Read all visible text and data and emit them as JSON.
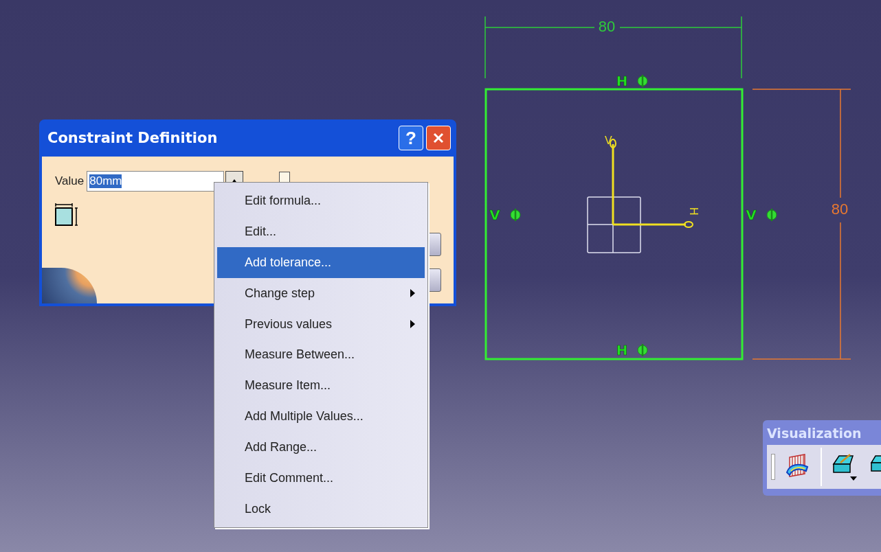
{
  "dialog": {
    "title": "Constraint Definition",
    "value_label": "Value",
    "value": "80mm",
    "value_selected": true,
    "help_glyph": "?",
    "reference_checked": false
  },
  "context_menu": {
    "items": [
      {
        "label": "Edit formula...",
        "selected": false,
        "submenu": false
      },
      {
        "label": "Edit...",
        "selected": false,
        "submenu": false
      },
      {
        "label": "Add tolerance...",
        "selected": true,
        "submenu": false
      },
      {
        "label": "Change step",
        "selected": false,
        "submenu": true
      },
      {
        "label": "Previous values",
        "selected": false,
        "submenu": true
      },
      {
        "label": "Measure Between...",
        "selected": false,
        "submenu": false
      },
      {
        "label": "Measure Item...",
        "selected": false,
        "submenu": false
      },
      {
        "label": "Add Multiple Values...",
        "selected": false,
        "submenu": false
      },
      {
        "label": "Add Range...",
        "selected": false,
        "submenu": false
      },
      {
        "label": "Edit Comment...",
        "selected": false,
        "submenu": false
      },
      {
        "label": "Lock",
        "selected": false,
        "submenu": false
      }
    ]
  },
  "sketch": {
    "width_dimension": "80",
    "height_dimension": "80",
    "constraints": [
      {
        "label": "H"
      },
      {
        "label": "V"
      },
      {
        "label": "V"
      },
      {
        "label": "H"
      }
    ],
    "axis_labels": {
      "vertical": "V",
      "horizontal": "H"
    }
  },
  "toolbar": {
    "title": "Visualization"
  }
}
